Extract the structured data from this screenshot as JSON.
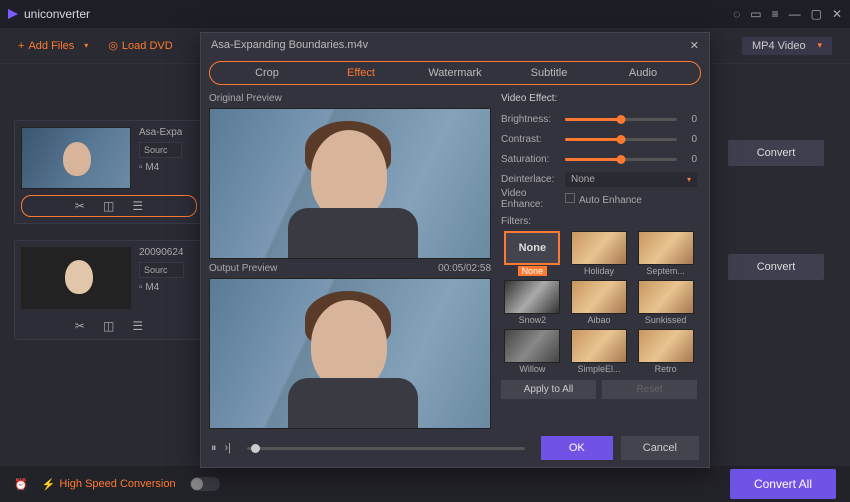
{
  "app": {
    "name": "uniconverter"
  },
  "toolbar": {
    "add_files": "Add Files",
    "load_dvd": "Load DVD",
    "output_format_value": "MP4 Video"
  },
  "files": [
    {
      "name": "Asa-Expa",
      "source": "Sourc",
      "format": "M4"
    },
    {
      "name": "20090624",
      "source": "Sourc",
      "format": "M4"
    }
  ],
  "convert_label": "Convert",
  "bottombar": {
    "high_speed": "High Speed Conversion",
    "convert_all": "Convert All"
  },
  "dialog": {
    "title": "Asa-Expanding Boundaries.m4v",
    "tabs": {
      "crop": "Crop",
      "effect": "Effect",
      "watermark": "Watermark",
      "subtitle": "Subtitle",
      "audio": "Audio"
    },
    "original_preview": "Original Preview",
    "output_preview": "Output Preview",
    "timecode": "00:05/02:58",
    "panel": {
      "video_effect": "Video Effect:",
      "brightness": "Brightness:",
      "contrast": "Contrast:",
      "saturation": "Saturation:",
      "deinterlace": "Deinterlace:",
      "deinterlace_value": "None",
      "video_enhance": "Video Enhance:",
      "auto_enhance": "Auto Enhance",
      "slider_value": "0"
    },
    "filters": {
      "label": "Filters:",
      "items": [
        "None",
        "Holiday",
        "Septem...",
        "Snow2",
        "Aibao",
        "Sunkissed",
        "Willow",
        "SimpleEl...",
        "Retro"
      ]
    },
    "apply_all": "Apply to All",
    "reset": "Reset",
    "ok": "OK",
    "cancel": "Cancel"
  }
}
